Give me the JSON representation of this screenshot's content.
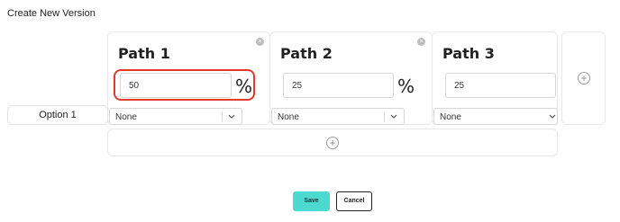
{
  "form": {
    "title": "Create New Version",
    "option_label": "Option 1",
    "percent_symbol": "%",
    "paths": [
      {
        "header": "Path 1",
        "value": "50",
        "select_value": "None"
      },
      {
        "header": "Path 2",
        "value": "25",
        "select_value": "None"
      },
      {
        "header": "Path 3",
        "value": "25",
        "select_value": "None"
      }
    ],
    "icons": {
      "remove": "close-icon",
      "add": "plus-icon",
      "dropdown": "chevron-down-icon"
    },
    "colors": {
      "highlight": "#e23b2b",
      "save_button": "#4dd8d0"
    }
  },
  "actions": {
    "save_label": "Save",
    "cancel_label": "Cancel"
  }
}
